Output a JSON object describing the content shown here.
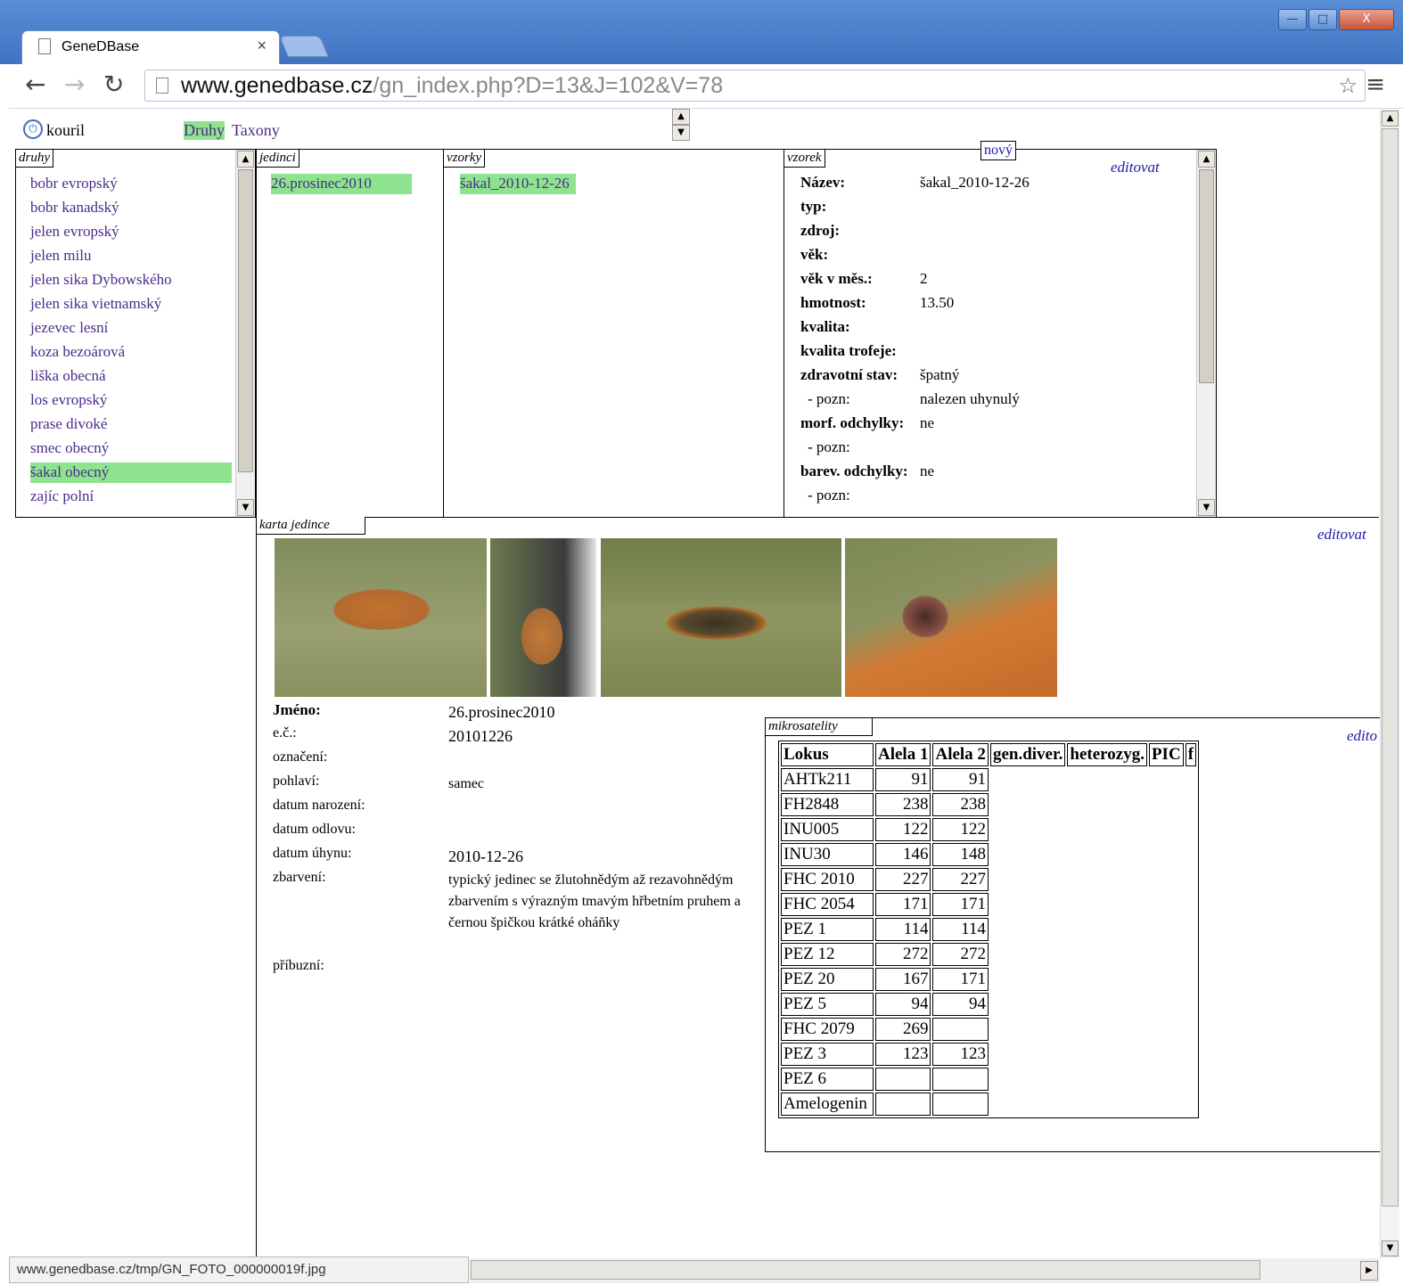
{
  "browser": {
    "tab_title": "GeneDBase",
    "url_domain": "www.genedbase.cz",
    "url_path": "/gn_index.php?D=13&J=102&V=78",
    "status_url": "www.genedbase.cz/tmp/GN_FOTO_000000019f.jpg"
  },
  "topbar": {
    "user": "kouril",
    "nav_active": "Druhy",
    "nav_other": "Taxony"
  },
  "druhy": {
    "label": "druhy",
    "items": [
      "bobr evropský",
      "bobr kanadský",
      "jelen evropský",
      "jelen milu",
      "jelen sika Dybowského",
      "jelen sika vietnamský",
      "jezevec lesní",
      "koza bezoárová",
      "liška obecná",
      "los evropský",
      "prase divoké",
      "smec obecný",
      "šakal obecný",
      "zajíc polní"
    ],
    "selected_index": 12
  },
  "jedinci": {
    "label": "jedinci",
    "items": [
      "26.prosinec2010"
    ]
  },
  "vzorky": {
    "label": "vzorky",
    "items": [
      "šakal_2010-12-26"
    ]
  },
  "vzorek": {
    "label": "vzorek",
    "new_label": "nový",
    "edit_label": "editovat",
    "fields": [
      {
        "label": "Název:",
        "value": "šakal_2010-12-26",
        "bold": true
      },
      {
        "label": "typ:",
        "value": "",
        "bold": true
      },
      {
        "label": "zdroj:",
        "value": "",
        "bold": true
      },
      {
        "label": "věk:",
        "value": "",
        "bold": true
      },
      {
        "label": "věk v měs.:",
        "value": "2",
        "bold": true
      },
      {
        "label": "hmotnost:",
        "value": "13.50",
        "bold": true
      },
      {
        "label": "kvalita:",
        "value": "",
        "bold": true
      },
      {
        "label": "kvalita trofeje:",
        "value": "",
        "bold": true
      },
      {
        "label": "zdravotní stav:",
        "value": "špatný",
        "bold": true
      },
      {
        "label": "- pozn:",
        "value": "nalezen uhynulý",
        "bold": false
      },
      {
        "label": "morf. odchylky:",
        "value": "ne",
        "bold": true
      },
      {
        "label": "- pozn:",
        "value": "",
        "bold": false
      },
      {
        "label": "barev. odchylky:",
        "value": "ne",
        "bold": true
      },
      {
        "label": "- pozn:",
        "value": "",
        "bold": false
      }
    ]
  },
  "karta": {
    "label": "karta jedince",
    "edit_label": "editovat",
    "rows": [
      {
        "label": "Jméno:",
        "value": "26.prosinec2010"
      },
      {
        "label": "e.č.:",
        "value": "20101226"
      },
      {
        "label": "označení:",
        "value": ""
      },
      {
        "label": "pohlaví:",
        "value": "samec"
      },
      {
        "label": "datum narození:",
        "value": ""
      },
      {
        "label": "datum odlovu:",
        "value": ""
      },
      {
        "label": "datum úhynu:",
        "value": "2010-12-26"
      },
      {
        "label": "zbarvení:",
        "value": "typický jedinec se žlutohnědým až rezavohnědým zbarvením s výrazným tmavým hřbetním pruhem a černou špičkou krátké oháňky"
      },
      {
        "label": "příbuzní:",
        "value": ""
      }
    ]
  },
  "mikro": {
    "label": "mikrosatelity",
    "edit_label": "edito",
    "headers": [
      "Lokus",
      "Alela 1",
      "Alela 2",
      "gen.diver.",
      "heterozyg.",
      "PIC",
      "f"
    ],
    "rows": [
      [
        "AHTk211",
        "91",
        "91"
      ],
      [
        "FH2848",
        "238",
        "238"
      ],
      [
        "INU005",
        "122",
        "122"
      ],
      [
        "INU30",
        "146",
        "148"
      ],
      [
        "FHC 2010",
        "227",
        "227"
      ],
      [
        "FHC 2054",
        "171",
        "171"
      ],
      [
        "PEZ 1",
        "114",
        "114"
      ],
      [
        "PEZ 12",
        "272",
        "272"
      ],
      [
        "PEZ 20",
        "167",
        "171"
      ],
      [
        "PEZ 5",
        "94",
        "94"
      ],
      [
        "FHC 2079",
        "269",
        ""
      ],
      [
        "PEZ 3",
        "123",
        "123"
      ],
      [
        "PEZ 6",
        "",
        ""
      ],
      [
        "Amelogenin",
        "",
        ""
      ]
    ]
  }
}
